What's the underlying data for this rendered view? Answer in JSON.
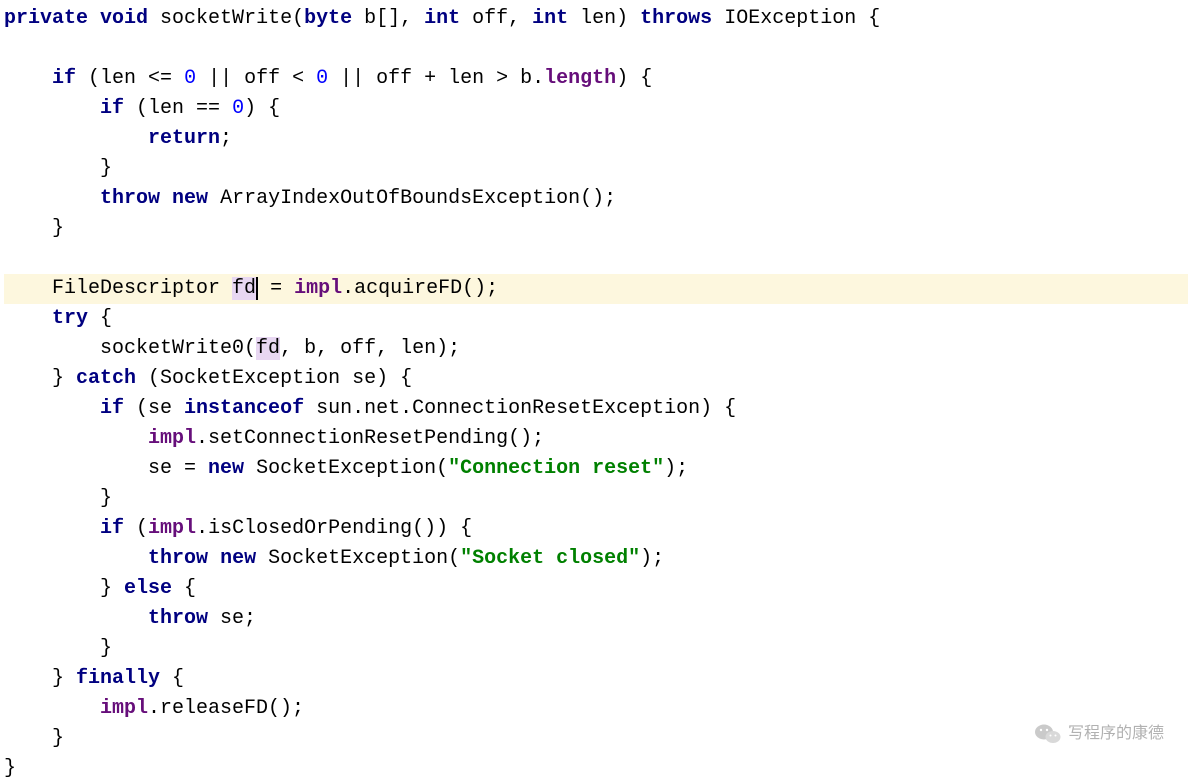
{
  "code": {
    "lines": [
      {
        "indent": 0,
        "segments": [
          {
            "t": "private",
            "c": "kw"
          },
          {
            "t": " "
          },
          {
            "t": "void",
            "c": "kw"
          },
          {
            "t": " socketWrite("
          },
          {
            "t": "byte",
            "c": "kw"
          },
          {
            "t": " b[], "
          },
          {
            "t": "int",
            "c": "kw"
          },
          {
            "t": " off, "
          },
          {
            "t": "int",
            "c": "kw"
          },
          {
            "t": " len) "
          },
          {
            "t": "throws",
            "c": "kw"
          },
          {
            "t": " IOException {"
          }
        ]
      },
      {
        "indent": 0,
        "segments": [
          {
            "t": " "
          }
        ]
      },
      {
        "indent": 1,
        "segments": [
          {
            "t": "if",
            "c": "kw"
          },
          {
            "t": " (len <= "
          },
          {
            "t": "0",
            "c": "num"
          },
          {
            "t": " || off < "
          },
          {
            "t": "0",
            "c": "num"
          },
          {
            "t": " || off + len > b."
          },
          {
            "t": "length",
            "c": "field"
          },
          {
            "t": ") {"
          }
        ]
      },
      {
        "indent": 2,
        "segments": [
          {
            "t": "if",
            "c": "kw"
          },
          {
            "t": " (len == "
          },
          {
            "t": "0",
            "c": "num"
          },
          {
            "t": ") {"
          }
        ]
      },
      {
        "indent": 3,
        "segments": [
          {
            "t": "return",
            "c": "kw"
          },
          {
            "t": ";"
          }
        ]
      },
      {
        "indent": 2,
        "segments": [
          {
            "t": "}"
          }
        ]
      },
      {
        "indent": 2,
        "segments": [
          {
            "t": "throw",
            "c": "kw"
          },
          {
            "t": " "
          },
          {
            "t": "new",
            "c": "kw"
          },
          {
            "t": " ArrayIndexOutOfBoundsException();"
          }
        ]
      },
      {
        "indent": 1,
        "segments": [
          {
            "t": "}"
          }
        ]
      },
      {
        "indent": 0,
        "segments": [
          {
            "t": " "
          }
        ]
      },
      {
        "indent": 1,
        "highlight": true,
        "segments": [
          {
            "t": "FileDescriptor "
          },
          {
            "t": "fd",
            "c": "sel"
          },
          {
            "t": "",
            "caret": true
          },
          {
            "t": " = "
          },
          {
            "t": "impl",
            "c": "field"
          },
          {
            "t": ".acquireFD();"
          }
        ]
      },
      {
        "indent": 1,
        "segments": [
          {
            "t": "try",
            "c": "kw"
          },
          {
            "t": " {"
          }
        ]
      },
      {
        "indent": 2,
        "segments": [
          {
            "t": "socketWrite0("
          },
          {
            "t": "fd",
            "c": "sel"
          },
          {
            "t": ", b, off, len);"
          }
        ]
      },
      {
        "indent": 1,
        "segments": [
          {
            "t": "} "
          },
          {
            "t": "catch",
            "c": "kw"
          },
          {
            "t": " (SocketException se) {"
          }
        ]
      },
      {
        "indent": 2,
        "segments": [
          {
            "t": "if",
            "c": "kw"
          },
          {
            "t": " (se "
          },
          {
            "t": "instanceof",
            "c": "kw"
          },
          {
            "t": " sun.net.ConnectionResetException) {"
          }
        ]
      },
      {
        "indent": 3,
        "segments": [
          {
            "t": "impl",
            "c": "field"
          },
          {
            "t": ".setConnectionResetPending();"
          }
        ]
      },
      {
        "indent": 3,
        "segments": [
          {
            "t": "se = "
          },
          {
            "t": "new",
            "c": "kw"
          },
          {
            "t": " SocketException("
          },
          {
            "t": "\"Connection reset\"",
            "c": "str"
          },
          {
            "t": ");"
          }
        ]
      },
      {
        "indent": 2,
        "segments": [
          {
            "t": "}"
          }
        ]
      },
      {
        "indent": 2,
        "segments": [
          {
            "t": "if",
            "c": "kw"
          },
          {
            "t": " ("
          },
          {
            "t": "impl",
            "c": "field"
          },
          {
            "t": ".isClosedOrPending()) {"
          }
        ]
      },
      {
        "indent": 3,
        "segments": [
          {
            "t": "throw",
            "c": "kw"
          },
          {
            "t": " "
          },
          {
            "t": "new",
            "c": "kw"
          },
          {
            "t": " SocketException("
          },
          {
            "t": "\"Socket closed\"",
            "c": "str"
          },
          {
            "t": ");"
          }
        ]
      },
      {
        "indent": 2,
        "segments": [
          {
            "t": "} "
          },
          {
            "t": "else",
            "c": "kw"
          },
          {
            "t": " {"
          }
        ]
      },
      {
        "indent": 3,
        "segments": [
          {
            "t": "throw",
            "c": "kw"
          },
          {
            "t": " se;"
          }
        ]
      },
      {
        "indent": 2,
        "segments": [
          {
            "t": "}"
          }
        ]
      },
      {
        "indent": 1,
        "segments": [
          {
            "t": "} "
          },
          {
            "t": "finally",
            "c": "kw"
          },
          {
            "t": " {"
          }
        ]
      },
      {
        "indent": 2,
        "segments": [
          {
            "t": "impl",
            "c": "field"
          },
          {
            "t": ".releaseFD();"
          }
        ]
      },
      {
        "indent": 1,
        "segments": [
          {
            "t": "}"
          }
        ]
      },
      {
        "indent": 0,
        "segments": [
          {
            "t": "}"
          }
        ]
      }
    ],
    "indent_unit": "    "
  },
  "watermark": {
    "text": "写程序的康德"
  }
}
